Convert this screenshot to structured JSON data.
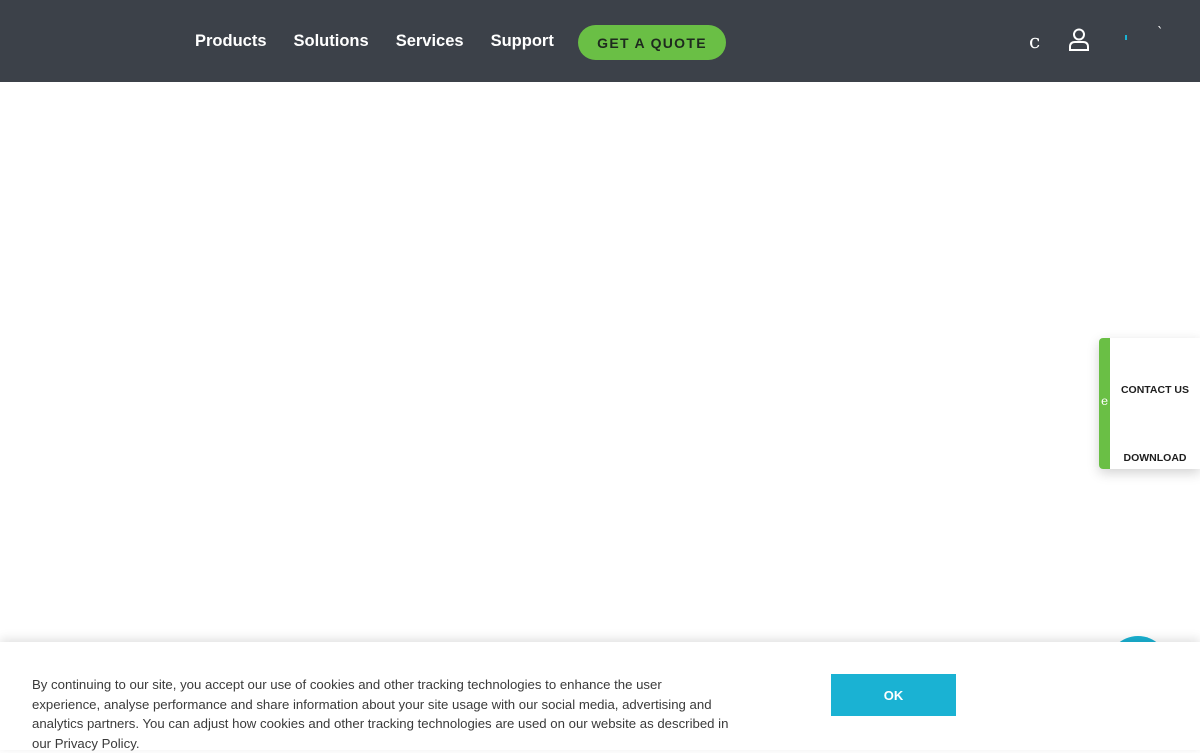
{
  "header": {
    "nav": [
      {
        "label": "Products"
      },
      {
        "label": "Solutions"
      },
      {
        "label": "Services"
      },
      {
        "label": "Support"
      }
    ],
    "cta_label": "GET A QUOTE",
    "icon_c_glyph": "c",
    "icon_tick_glyph": "`"
  },
  "side_panel": {
    "strip_glyph": "e",
    "contact_label": "CONTACT US",
    "download_label": "DOWNLOAD"
  },
  "cookie": {
    "text": "By continuing to our site, you accept our use of cookies and other tracking technologies to enhance the user experience, analyse performance and share information about your site usage with our social media, advertising and analytics partners. You can adjust how cookies and other tracking technologies are used on our website as described in our Privacy Policy.",
    "ok_label": "OK"
  },
  "colors": {
    "header_bg": "#3c4149",
    "accent_green": "#6abf45",
    "accent_teal": "#1ab2d3"
  }
}
